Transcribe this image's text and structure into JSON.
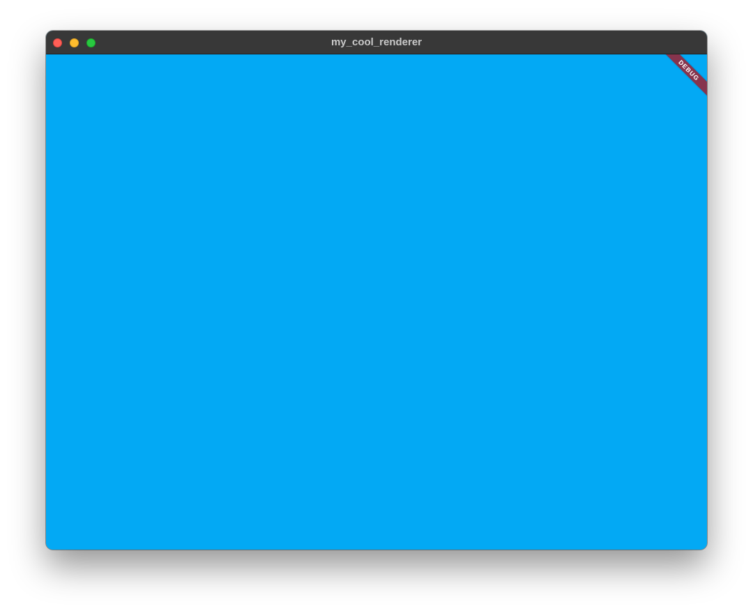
{
  "window": {
    "title": "my_cool_renderer"
  },
  "content": {
    "background_color": "#03a9f4",
    "debug_banner_label": "DEBUG",
    "debug_banner_color": "#86344d"
  },
  "colors": {
    "close": "#ff5f57",
    "minimize": "#febc2e",
    "maximize": "#28c840",
    "titlebar": "#383838"
  }
}
